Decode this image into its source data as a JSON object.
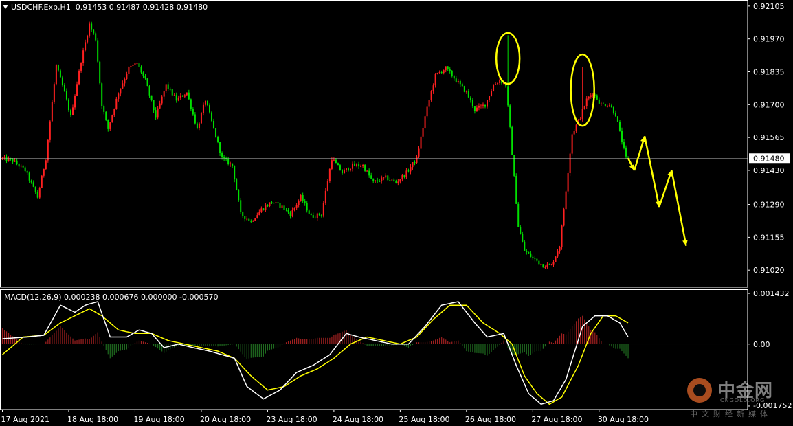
{
  "chart_header": {
    "symbol": "USDCHF.Exp,H1",
    "ohlc": "0.91453 0.91487 0.91428 0.91480"
  },
  "macd_header": {
    "label": "MACD(12,26,9) 0.000238 0.000676 0.000000 -0.000570"
  },
  "watermark": {
    "name": "中金网",
    "sub": "CNGOLD.ORG",
    "tag": "中文财经新媒体"
  },
  "colors": {
    "background": "#000000",
    "bull": "#ff2020",
    "bear": "#00e000",
    "wick": "#ffffff",
    "macd_main": "#ffffff",
    "macd_signal": "#ffff00",
    "hist_pos": "#a02020",
    "hist_neg": "#1f6b1f",
    "annotation": "#ffff00",
    "current_price_line": "#c0c0c0"
  },
  "chart_data": [
    {
      "type": "candlestick",
      "title": "USDCHF.Exp,H1",
      "y_ticks": [
        "0.92105",
        "0.91970",
        "0.91835",
        "0.91700",
        "0.91565",
        "0.91430",
        "0.91290",
        "0.91155",
        "0.91020"
      ],
      "ylim": [
        0.9095,
        0.9213
      ],
      "current_price": "0.91480",
      "x_ticks": [
        "17 Aug 2021",
        "18 Aug 18:00",
        "19 Aug 18:00",
        "20 Aug 18:00",
        "23 Aug 18:00",
        "24 Aug 18:00",
        "25 Aug 18:00",
        "26 Aug 18:00",
        "27 Aug 18:00",
        "30 Aug 18:00"
      ],
      "grid": false,
      "path_anchors": [
        [
          0,
          0.9148
        ],
        [
          6,
          0.9147
        ],
        [
          12,
          0.9143
        ],
        [
          18,
          0.9132
        ],
        [
          22,
          0.9148
        ],
        [
          27,
          0.9186
        ],
        [
          31,
          0.9175
        ],
        [
          34,
          0.9165
        ],
        [
          39,
          0.9188
        ],
        [
          43,
          0.9203
        ],
        [
          46,
          0.9197
        ],
        [
          49,
          0.917
        ],
        [
          52,
          0.916
        ],
        [
          57,
          0.9175
        ],
        [
          62,
          0.9185
        ],
        [
          66,
          0.9187
        ],
        [
          70,
          0.918
        ],
        [
          75,
          0.9165
        ],
        [
          80,
          0.9178
        ],
        [
          85,
          0.9172
        ],
        [
          90,
          0.9175
        ],
        [
          95,
          0.916
        ],
        [
          99,
          0.9172
        ],
        [
          103,
          0.916
        ],
        [
          107,
          0.9148
        ],
        [
          112,
          0.9145
        ],
        [
          116,
          0.9125
        ],
        [
          121,
          0.9122
        ],
        [
          126,
          0.9127
        ],
        [
          131,
          0.913
        ],
        [
          136,
          0.9128
        ],
        [
          140,
          0.9125
        ],
        [
          145,
          0.9132
        ],
        [
          150,
          0.9124
        ],
        [
          155,
          0.9125
        ],
        [
          160,
          0.9148
        ],
        [
          165,
          0.9142
        ],
        [
          170,
          0.9145
        ],
        [
          175,
          0.9145
        ],
        [
          180,
          0.9138
        ],
        [
          186,
          0.914
        ],
        [
          191,
          0.9138
        ],
        [
          196,
          0.9142
        ],
        [
          201,
          0.9148
        ],
        [
          205,
          0.9165
        ],
        [
          210,
          0.9182
        ],
        [
          215,
          0.9185
        ],
        [
          220,
          0.918
        ],
        [
          225,
          0.9175
        ],
        [
          229,
          0.9168
        ],
        [
          234,
          0.917
        ],
        [
          238,
          0.9178
        ],
        [
          241,
          0.918
        ],
        [
          244,
          0.9178
        ],
        [
          246,
          0.916
        ],
        [
          248,
          0.914
        ],
        [
          250,
          0.912
        ],
        [
          253,
          0.911
        ],
        [
          257,
          0.9107
        ],
        [
          262,
          0.9104
        ],
        [
          266,
          0.9104
        ],
        [
          270,
          0.9112
        ],
        [
          273,
          0.9135
        ],
        [
          276,
          0.9158
        ],
        [
          280,
          0.9165
        ],
        [
          283,
          0.9172
        ],
        [
          286,
          0.9175
        ],
        [
          290,
          0.917
        ],
        [
          294,
          0.917
        ],
        [
          297,
          0.9166
        ],
        [
          300,
          0.9155
        ],
        [
          302,
          0.9148
        ]
      ],
      "spikes": [
        {
          "bar": 244,
          "high": 0.91985
        },
        {
          "bar": 280,
          "high": 0.91855
        }
      ],
      "annotations": {
        "circles": [
          "2021-08-26 spike high",
          "2021-08-27 spike high"
        ],
        "projected_path": [
          [
            302,
            0.9148
          ],
          [
            305,
            0.9143
          ],
          [
            310,
            0.9157
          ],
          [
            317,
            0.9128
          ],
          [
            323,
            0.9143
          ],
          [
            330,
            0.9112
          ]
        ]
      }
    },
    {
      "type": "macd",
      "title": "MACD(12,26,9)",
      "params": [
        12,
        26,
        9
      ],
      "values": {
        "main": 0.000238,
        "signal": 0.000676,
        "extra1": 0.0,
        "extra2": -0.00057
      },
      "y_ticks": [
        "0.001432",
        "0.00",
        "-0.001752"
      ],
      "ylim": [
        -0.00185,
        0.00155
      ],
      "main_anchors": [
        [
          0,
          0.00015
        ],
        [
          12,
          0.0002
        ],
        [
          20,
          0.00025
        ],
        [
          28,
          0.0011
        ],
        [
          35,
          0.0009
        ],
        [
          40,
          0.0011
        ],
        [
          46,
          0.0012
        ],
        [
          52,
          0.0002
        ],
        [
          60,
          0.0002
        ],
        [
          66,
          0.0004
        ],
        [
          72,
          0.0003
        ],
        [
          78,
          -0.0001
        ],
        [
          85,
          0.0
        ],
        [
          92,
          -0.0001
        ],
        [
          100,
          -0.0002
        ],
        [
          106,
          -0.0003
        ],
        [
          112,
          -0.0004
        ],
        [
          118,
          -0.0012
        ],
        [
          126,
          -0.00155
        ],
        [
          134,
          -0.0013
        ],
        [
          142,
          -0.0008
        ],
        [
          150,
          -0.0006
        ],
        [
          158,
          -0.0003
        ],
        [
          166,
          0.0003
        ],
        [
          172,
          0.0002
        ],
        [
          180,
          0.0001
        ],
        [
          188,
          0.0
        ],
        [
          196,
          0.0
        ],
        [
          204,
          0.0005
        ],
        [
          212,
          0.0011
        ],
        [
          220,
          0.0012
        ],
        [
          228,
          0.0006
        ],
        [
          234,
          0.0002
        ],
        [
          242,
          0.0003
        ],
        [
          248,
          -0.0006
        ],
        [
          254,
          -0.0014
        ],
        [
          260,
          -0.0017
        ],
        [
          266,
          -0.0016
        ],
        [
          272,
          -0.001
        ],
        [
          280,
          0.0005
        ],
        [
          286,
          0.0008
        ],
        [
          292,
          0.0008
        ],
        [
          298,
          0.0006
        ],
        [
          302,
          0.0002
        ]
      ],
      "signal_anchors": [
        [
          0,
          -0.0003
        ],
        [
          10,
          0.0002
        ],
        [
          20,
          0.00025
        ],
        [
          28,
          0.0006
        ],
        [
          35,
          0.0008
        ],
        [
          42,
          0.001
        ],
        [
          48,
          0.0008
        ],
        [
          56,
          0.0004
        ],
        [
          64,
          0.0003
        ],
        [
          72,
          0.0003
        ],
        [
          80,
          0.0001
        ],
        [
          88,
          0.0
        ],
        [
          96,
          -0.0001
        ],
        [
          104,
          -0.0002
        ],
        [
          112,
          -0.0004
        ],
        [
          120,
          -0.0009
        ],
        [
          128,
          -0.0013
        ],
        [
          136,
          -0.0012
        ],
        [
          144,
          -0.0009
        ],
        [
          152,
          -0.0007
        ],
        [
          160,
          -0.0004
        ],
        [
          168,
          0.0
        ],
        [
          176,
          0.0002
        ],
        [
          184,
          0.0001
        ],
        [
          192,
          0.0
        ],
        [
          200,
          0.0002
        ],
        [
          208,
          0.0007
        ],
        [
          216,
          0.0011
        ],
        [
          224,
          0.0011
        ],
        [
          232,
          0.0006
        ],
        [
          240,
          0.0003
        ],
        [
          246,
          0.0
        ],
        [
          252,
          -0.0009
        ],
        [
          258,
          -0.0014
        ],
        [
          264,
          -0.0017
        ],
        [
          270,
          -0.0015
        ],
        [
          278,
          -0.0006
        ],
        [
          284,
          0.0003
        ],
        [
          290,
          0.0008
        ],
        [
          296,
          0.0008
        ],
        [
          302,
          0.0006
        ]
      ]
    }
  ]
}
